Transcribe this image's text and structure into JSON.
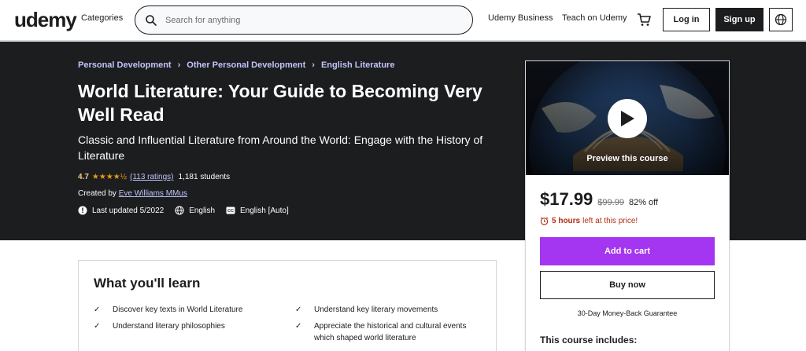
{
  "header": {
    "logo": "udemy",
    "categories": "Categories",
    "search_placeholder": "Search for anything",
    "udemy_business": "Udemy Business",
    "teach": "Teach on Udemy",
    "login": "Log in",
    "signup": "Sign up"
  },
  "breadcrumb": [
    "Personal Development",
    "Other Personal Development",
    "English Literature"
  ],
  "course": {
    "title": "World Literature: Your Guide to Becoming Very Well Read",
    "subtitle": "Classic and Influential Literature from Around the World: Engage with the History of Literature",
    "rating": "4.7",
    "rating_count": "(113 ratings)",
    "students": "1,181 students",
    "created_by_label": "Created by",
    "author": "Eve Williams MMus",
    "last_updated": "Last updated 5/2022",
    "language": "English",
    "captions": "English [Auto]"
  },
  "card": {
    "preview_label": "Preview this course",
    "price": "$17.99",
    "old_price": "$99.99",
    "discount": "82% off",
    "timer_hours": "5 hours",
    "timer_suffix": "left at this price!",
    "add_to_cart": "Add to cart",
    "buy_now": "Buy now",
    "guarantee": "30-Day Money-Back Guarantee",
    "includes_title": "This course includes:"
  },
  "learn": {
    "title": "What you'll learn",
    "items": [
      "Discover key texts in World Literature",
      "Understand key literary movements",
      "Understand literary philosophies",
      "Appreciate the historical and cultural events which shaped world literature"
    ]
  },
  "colors": {
    "accent": "#a435f0",
    "dark": "#1c1d1f",
    "link_light": "#c0c4fc",
    "star": "#e59819",
    "alert": "#b32d0f"
  }
}
